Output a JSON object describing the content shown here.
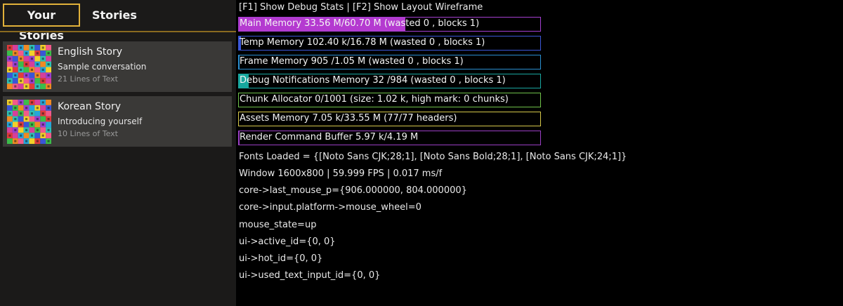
{
  "tabs": {
    "your_stories": "Your Stories",
    "stories": "Stories"
  },
  "stories": [
    {
      "title": "English Story",
      "subtitle": "Sample conversation",
      "lines": "21 Lines of Text"
    },
    {
      "title": "Korean Story",
      "subtitle": "Introducing yourself",
      "lines": "10 Lines of Text"
    }
  ],
  "debug": {
    "hint": "[F1] Show Debug Stats | [F2] Show Layout Wireframe",
    "memory": [
      {
        "label": "Main Memory 33.56 M/60.70 M (wasted 0 , blocks 1)",
        "usage": 0.553,
        "border": "#a43fd1",
        "fill": "#b43ad0"
      },
      {
        "label": "Temp Memory 102.40 k/16.78 M (wasted 0 , blocks 1)",
        "usage": 0.006,
        "border": "#3b57d8",
        "fill": "#3b57d8"
      },
      {
        "label": "Frame Memory 905 /1.05 M (wasted 0 , blocks 1)",
        "usage": 0.001,
        "border": "#2a8fd1",
        "fill": "#2a8fd1"
      },
      {
        "label": "Debug Notifications Memory 32 /984  (wasted 0 , blocks 1)",
        "usage": 0.033,
        "border": "#1aa7a0",
        "fill": "#17a79e"
      },
      {
        "label": "Chunk Allocator 0/1001 (size: 1.02 k, high mark: 0 chunks)",
        "usage": 0,
        "border": "#6fc24a",
        "fill": "#6fc24a"
      },
      {
        "label": "Assets Memory 7.05 k/33.55 M (77/77 headers)",
        "usage": 0,
        "border": "#d6c84a",
        "fill": "#d6c84a"
      },
      {
        "label": "Render Command Buffer 5.97 k/4.19 M",
        "usage": 0.001,
        "border": "#9b3fc4",
        "fill": "#9b3fc4"
      }
    ],
    "lines": [
      "Fonts Loaded = {[Noto Sans CJK;28;1], [Noto Sans Bold;28;1], [Noto Sans CJK;24;1]}",
      "Window 1600x800 | 59.999 FPS | 0.017 ms/f",
      "core->last_mouse_p={906.000000, 804.000000}",
      "core->input.platform->mouse_wheel=0",
      "mouse_state=up",
      "ui->active_id={0, 0}",
      "ui->hot_id={0, 0}",
      "ui->used_text_input_id={0, 0}"
    ]
  }
}
